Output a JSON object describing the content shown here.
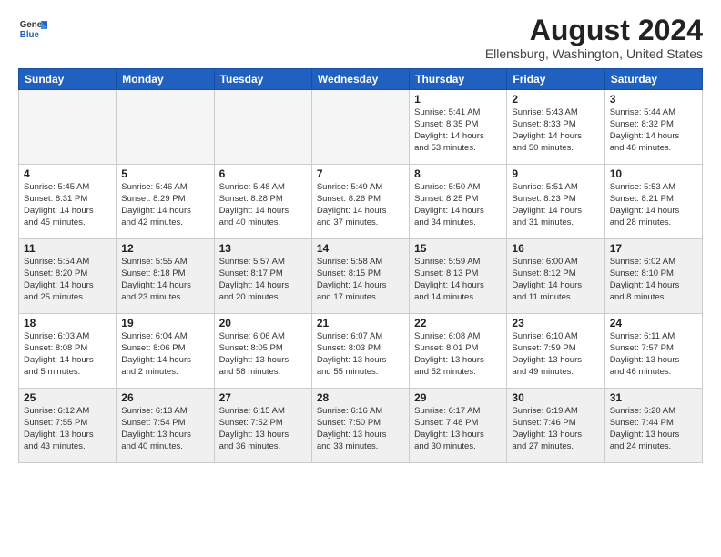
{
  "header": {
    "logo": {
      "general": "General",
      "blue": "Blue"
    },
    "title": "August 2024",
    "location": "Ellensburg, Washington, United States"
  },
  "weekdays": [
    "Sunday",
    "Monday",
    "Tuesday",
    "Wednesday",
    "Thursday",
    "Friday",
    "Saturday"
  ],
  "weeks": [
    [
      {
        "day": "",
        "info": ""
      },
      {
        "day": "",
        "info": ""
      },
      {
        "day": "",
        "info": ""
      },
      {
        "day": "",
        "info": ""
      },
      {
        "day": "1",
        "info": "Sunrise: 5:41 AM\nSunset: 8:35 PM\nDaylight: 14 hours\nand 53 minutes."
      },
      {
        "day": "2",
        "info": "Sunrise: 5:43 AM\nSunset: 8:33 PM\nDaylight: 14 hours\nand 50 minutes."
      },
      {
        "day": "3",
        "info": "Sunrise: 5:44 AM\nSunset: 8:32 PM\nDaylight: 14 hours\nand 48 minutes."
      }
    ],
    [
      {
        "day": "4",
        "info": "Sunrise: 5:45 AM\nSunset: 8:31 PM\nDaylight: 14 hours\nand 45 minutes."
      },
      {
        "day": "5",
        "info": "Sunrise: 5:46 AM\nSunset: 8:29 PM\nDaylight: 14 hours\nand 42 minutes."
      },
      {
        "day": "6",
        "info": "Sunrise: 5:48 AM\nSunset: 8:28 PM\nDaylight: 14 hours\nand 40 minutes."
      },
      {
        "day": "7",
        "info": "Sunrise: 5:49 AM\nSunset: 8:26 PM\nDaylight: 14 hours\nand 37 minutes."
      },
      {
        "day": "8",
        "info": "Sunrise: 5:50 AM\nSunset: 8:25 PM\nDaylight: 14 hours\nand 34 minutes."
      },
      {
        "day": "9",
        "info": "Sunrise: 5:51 AM\nSunset: 8:23 PM\nDaylight: 14 hours\nand 31 minutes."
      },
      {
        "day": "10",
        "info": "Sunrise: 5:53 AM\nSunset: 8:21 PM\nDaylight: 14 hours\nand 28 minutes."
      }
    ],
    [
      {
        "day": "11",
        "info": "Sunrise: 5:54 AM\nSunset: 8:20 PM\nDaylight: 14 hours\nand 25 minutes."
      },
      {
        "day": "12",
        "info": "Sunrise: 5:55 AM\nSunset: 8:18 PM\nDaylight: 14 hours\nand 23 minutes."
      },
      {
        "day": "13",
        "info": "Sunrise: 5:57 AM\nSunset: 8:17 PM\nDaylight: 14 hours\nand 20 minutes."
      },
      {
        "day": "14",
        "info": "Sunrise: 5:58 AM\nSunset: 8:15 PM\nDaylight: 14 hours\nand 17 minutes."
      },
      {
        "day": "15",
        "info": "Sunrise: 5:59 AM\nSunset: 8:13 PM\nDaylight: 14 hours\nand 14 minutes."
      },
      {
        "day": "16",
        "info": "Sunrise: 6:00 AM\nSunset: 8:12 PM\nDaylight: 14 hours\nand 11 minutes."
      },
      {
        "day": "17",
        "info": "Sunrise: 6:02 AM\nSunset: 8:10 PM\nDaylight: 14 hours\nand 8 minutes."
      }
    ],
    [
      {
        "day": "18",
        "info": "Sunrise: 6:03 AM\nSunset: 8:08 PM\nDaylight: 14 hours\nand 5 minutes."
      },
      {
        "day": "19",
        "info": "Sunrise: 6:04 AM\nSunset: 8:06 PM\nDaylight: 14 hours\nand 2 minutes."
      },
      {
        "day": "20",
        "info": "Sunrise: 6:06 AM\nSunset: 8:05 PM\nDaylight: 13 hours\nand 58 minutes."
      },
      {
        "day": "21",
        "info": "Sunrise: 6:07 AM\nSunset: 8:03 PM\nDaylight: 13 hours\nand 55 minutes."
      },
      {
        "day": "22",
        "info": "Sunrise: 6:08 AM\nSunset: 8:01 PM\nDaylight: 13 hours\nand 52 minutes."
      },
      {
        "day": "23",
        "info": "Sunrise: 6:10 AM\nSunset: 7:59 PM\nDaylight: 13 hours\nand 49 minutes."
      },
      {
        "day": "24",
        "info": "Sunrise: 6:11 AM\nSunset: 7:57 PM\nDaylight: 13 hours\nand 46 minutes."
      }
    ],
    [
      {
        "day": "25",
        "info": "Sunrise: 6:12 AM\nSunset: 7:55 PM\nDaylight: 13 hours\nand 43 minutes."
      },
      {
        "day": "26",
        "info": "Sunrise: 6:13 AM\nSunset: 7:54 PM\nDaylight: 13 hours\nand 40 minutes."
      },
      {
        "day": "27",
        "info": "Sunrise: 6:15 AM\nSunset: 7:52 PM\nDaylight: 13 hours\nand 36 minutes."
      },
      {
        "day": "28",
        "info": "Sunrise: 6:16 AM\nSunset: 7:50 PM\nDaylight: 13 hours\nand 33 minutes."
      },
      {
        "day": "29",
        "info": "Sunrise: 6:17 AM\nSunset: 7:48 PM\nDaylight: 13 hours\nand 30 minutes."
      },
      {
        "day": "30",
        "info": "Sunrise: 6:19 AM\nSunset: 7:46 PM\nDaylight: 13 hours\nand 27 minutes."
      },
      {
        "day": "31",
        "info": "Sunrise: 6:20 AM\nSunset: 7:44 PM\nDaylight: 13 hours\nand 24 minutes."
      }
    ]
  ]
}
